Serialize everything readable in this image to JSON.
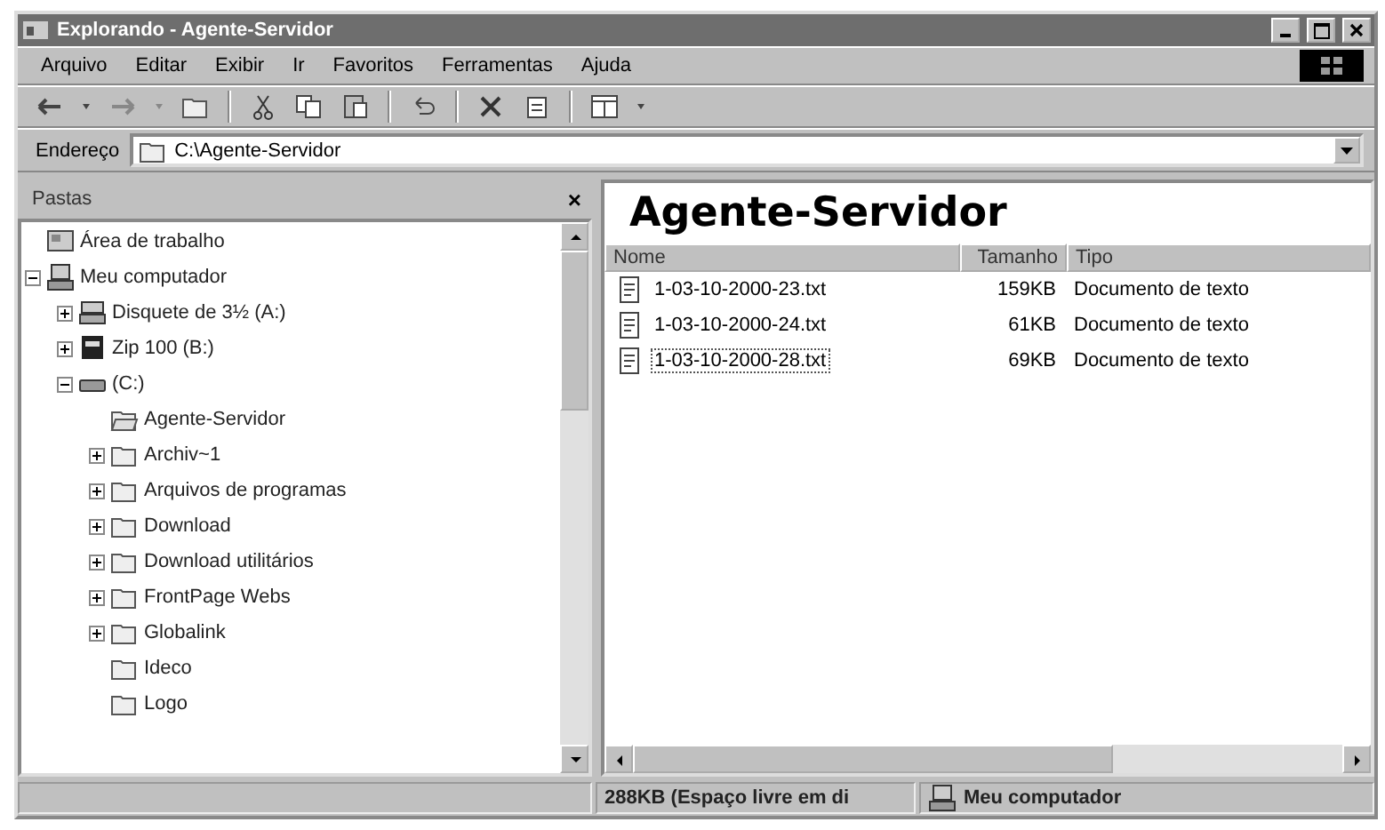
{
  "window": {
    "title": "Explorando - Agente-Servidor"
  },
  "menu": [
    "Arquivo",
    "Editar",
    "Exibir",
    "Ir",
    "Favoritos",
    "Ferramentas",
    "Ajuda"
  ],
  "address": {
    "label": "Endereço",
    "value": "C:\\Agente-Servidor"
  },
  "folders_pane": {
    "title": "Pastas",
    "close": "×",
    "tree": [
      {
        "label": "Área de trabalho",
        "kind": "desktop"
      },
      {
        "label": "Meu computador",
        "kind": "computer",
        "expanded": true,
        "children": [
          {
            "label": "Disquete de 3½ (A:)",
            "kind": "floppy",
            "expanded": false
          },
          {
            "label": "Zip 100 (B:)",
            "kind": "zip",
            "expanded": false
          },
          {
            "label": "(C:)",
            "kind": "drive",
            "expanded": true,
            "children": [
              {
                "label": "Agente-Servidor",
                "kind": "openfolder"
              },
              {
                "label": "Archiv~1",
                "kind": "folder",
                "expanded": false
              },
              {
                "label": "Arquivos de programas",
                "kind": "folder",
                "expanded": false
              },
              {
                "label": "Download",
                "kind": "folder",
                "expanded": false
              },
              {
                "label": "Download utilitários",
                "kind": "folder",
                "expanded": false
              },
              {
                "label": "FrontPage Webs",
                "kind": "folder",
                "expanded": false
              },
              {
                "label": "Globalink",
                "kind": "folder",
                "expanded": false
              },
              {
                "label": "Ideco",
                "kind": "folder"
              },
              {
                "label": "Logo",
                "kind": "folder"
              }
            ]
          }
        ]
      }
    ]
  },
  "content": {
    "heading": "Agente-Servidor",
    "columns": [
      "Nome",
      "Tamanho",
      "Tipo"
    ],
    "rows": [
      {
        "name": "1-03-10-2000-23.txt",
        "size": "159KB",
        "type": "Documento de texto",
        "focused": false
      },
      {
        "name": "1-03-10-2000-24.txt",
        "size": "61KB",
        "type": "Documento de texto",
        "focused": false
      },
      {
        "name": "1-03-10-2000-28.txt",
        "size": "69KB",
        "type": "Documento de texto",
        "focused": true
      }
    ]
  },
  "status_bar": {
    "free_space": "288KB (Espaço livre em di",
    "location": "Meu computador"
  }
}
